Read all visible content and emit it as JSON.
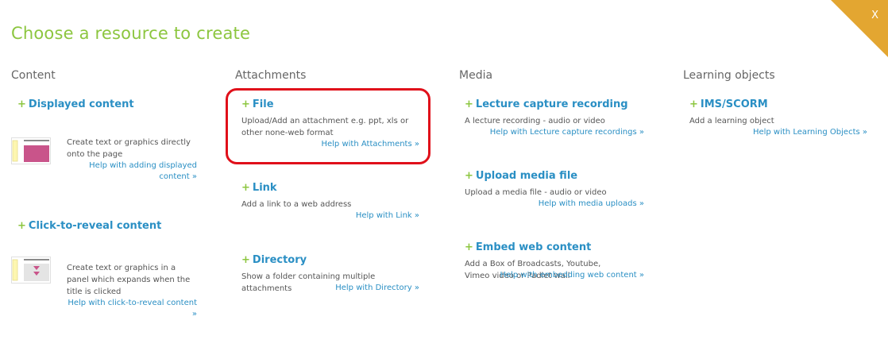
{
  "title": "Choose a resource to create",
  "close_label": "X",
  "columns": {
    "content": "Content",
    "attachments": "Attachments",
    "media": "Media",
    "learning": "Learning objects"
  },
  "plus": "+",
  "resources": {
    "displayed": {
      "title": "Displayed content",
      "desc": "Create text or graphics directly onto the page",
      "help": "Help with adding displayed content »"
    },
    "reveal": {
      "title": "Click-to-reveal content",
      "desc": "Create text or graphics in a panel which expands when the title is clicked",
      "help": "Help with click-to-reveal content »"
    },
    "file": {
      "title": "File",
      "desc": "Upload/Add an attachment e.g. ppt, xls or other none-web format",
      "help": "Help with Attachments »"
    },
    "link": {
      "title": "Link",
      "desc": "Add a link to a web address",
      "help": "Help with Link »"
    },
    "directory": {
      "title": "Directory",
      "desc": "Show a folder containing multiple attachments",
      "help": "Help with Directory »"
    },
    "lecture": {
      "title": "Lecture capture recording",
      "desc": "A lecture recording - audio or video",
      "help": "Help with Lecture capture recordings »"
    },
    "upload_media": {
      "title": "Upload media file",
      "desc": "Upload a media file - audio or video",
      "help": "Help with media uploads »"
    },
    "embed": {
      "title": "Embed web content",
      "desc": "Add a Box of Broadcasts, Youtube, Vimeo video or Padlet wall",
      "help": "Help with embedding web content »"
    },
    "ims": {
      "title": "IMS/SCORM",
      "desc": "Add a learning object",
      "help": "Help with Learning Objects »"
    }
  },
  "colors": {
    "title_green": "#8cc63f",
    "link_blue": "#2a8fc4",
    "close_gold": "#e3a631",
    "highlight_red": "#e0101a"
  }
}
